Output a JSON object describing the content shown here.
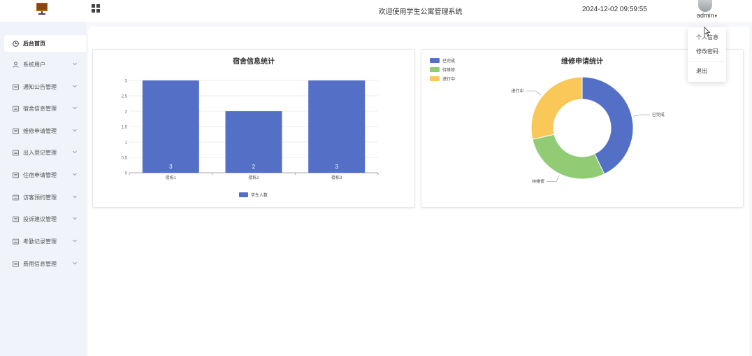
{
  "header": {
    "welcome": "欢迎使用学生公寓管理系统",
    "datetime": "2024-12-02 09:59:55",
    "user": "admin",
    "logo_icon": "monitor-icon",
    "menu_toggle_icon": "grid-icon"
  },
  "sidebar": {
    "items": [
      {
        "label": "后台首页",
        "icon": "clock-icon",
        "active": true
      },
      {
        "label": "系统用户",
        "icon": "user-icon"
      },
      {
        "label": "通知公告管理",
        "icon": "list-icon"
      },
      {
        "label": "宿舍信息管理",
        "icon": "list-icon"
      },
      {
        "label": "维修申请管理",
        "icon": "list-icon"
      },
      {
        "label": "出入登记管理",
        "icon": "list-icon"
      },
      {
        "label": "住宿申请管理",
        "icon": "list-icon"
      },
      {
        "label": "访客预约管理",
        "icon": "list-icon"
      },
      {
        "label": "投诉建议管理",
        "icon": "list-icon"
      },
      {
        "label": "考勤记录管理",
        "icon": "list-icon"
      },
      {
        "label": "费用信息管理",
        "icon": "list-icon"
      }
    ]
  },
  "dropdown": {
    "items": [
      "个人信息",
      "修改密码",
      "退出"
    ]
  },
  "colors": {
    "bar": "#5470c6",
    "completed": "#5470c6",
    "pending": "#91cc75",
    "in_progress": "#fac858"
  },
  "chart_data": [
    {
      "type": "bar",
      "title": "宿舍信息统计",
      "categories": [
        "楼栋1",
        "楼栋2",
        "楼栋3"
      ],
      "series": [
        {
          "name": "学生人数",
          "values": [
            3,
            2,
            3
          ]
        }
      ],
      "yticks": [
        "0",
        "0.5",
        "1",
        "1.5",
        "2",
        "2.5",
        "3"
      ],
      "ylim": [
        0,
        3
      ],
      "legend": "bottom"
    },
    {
      "type": "pie",
      "title": "维修申请统计",
      "donut": true,
      "legend": "top-left",
      "slices": [
        {
          "name": "已完成",
          "value": 3
        },
        {
          "name": "待维修",
          "value": 2
        },
        {
          "name": "进行中",
          "value": 2
        }
      ]
    }
  ]
}
